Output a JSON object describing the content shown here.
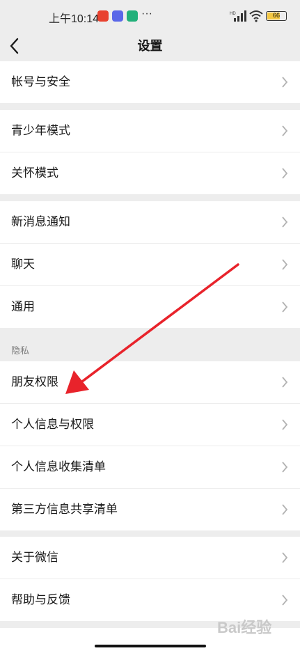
{
  "status_bar": {
    "time": "上午10:14",
    "battery": "66",
    "dots": "···"
  },
  "header": {
    "title": "设置"
  },
  "sections": [
    {
      "items": [
        "帐号与安全"
      ]
    },
    {
      "items": [
        "青少年模式",
        "关怀模式"
      ]
    },
    {
      "items": [
        "新消息通知",
        "聊天",
        "通用"
      ]
    },
    {
      "header": "隐私",
      "items": [
        "朋友权限",
        "个人信息与权限",
        "个人信息收集清单",
        "第三方信息共享清单"
      ]
    },
    {
      "items": [
        "关于微信",
        "帮助与反馈"
      ]
    }
  ],
  "colors": {
    "background": "#ededed",
    "row_background": "#ffffff",
    "annotation_arrow": "#e8232b"
  },
  "watermark": "Bai经验"
}
